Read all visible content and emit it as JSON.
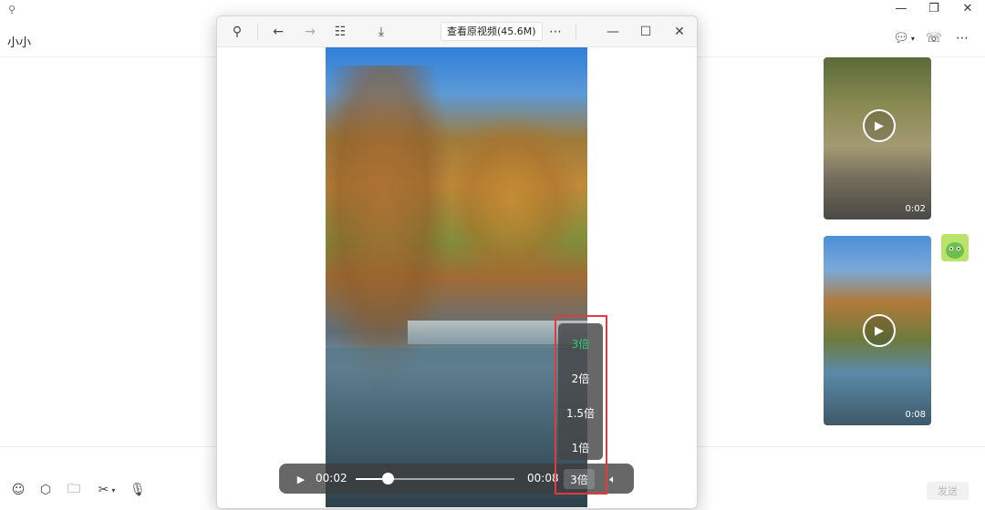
{
  "chat": {
    "contact_name": "小小",
    "send_label": "发送",
    "videos": [
      {
        "duration": "0:02"
      },
      {
        "duration": "0:08"
      }
    ]
  },
  "viewer": {
    "original_button": "查看原视频(45.6M)",
    "player": {
      "current_time": "00:02",
      "total_time": "00:08",
      "progress": 0.2,
      "speed_label": "3倍"
    },
    "speed_menu": {
      "options": [
        "3倍",
        "2倍",
        "1.5倍",
        "1倍"
      ],
      "selected": "3倍"
    }
  },
  "colors": {
    "highlight_box": "#e23b3b",
    "selected_speed": "#2ecc71"
  },
  "icons": [
    "pin-icon",
    "minimize-icon",
    "restore-icon",
    "close-icon",
    "chat-bubble-icon",
    "call-icon",
    "more-icon",
    "back-icon",
    "forward-icon",
    "grid-icon",
    "download-icon",
    "play-icon",
    "volume-icon",
    "emoji-icon",
    "box-icon",
    "folder-icon",
    "scissors-icon",
    "mic-icon"
  ]
}
